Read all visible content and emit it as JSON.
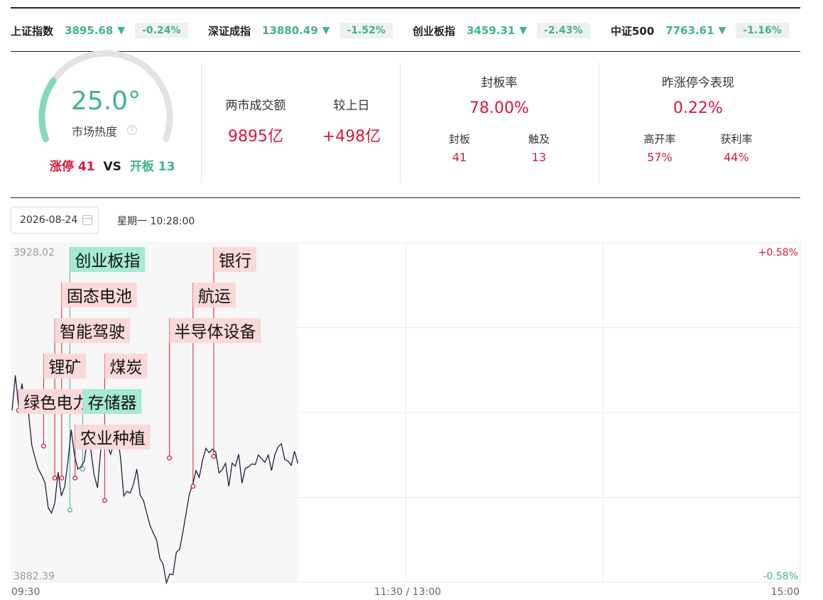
{
  "indices": [
    {
      "name": "上证指数",
      "value": "3895.68",
      "arrow": "▼",
      "change": "-0.24%"
    },
    {
      "name": "深证成指",
      "value": "13880.49",
      "arrow": "▼",
      "change": "-1.52%"
    },
    {
      "name": "创业板指",
      "value": "3459.31",
      "arrow": "▼",
      "change": "-2.43%"
    },
    {
      "name": "中证500",
      "value": "7763.61",
      "arrow": "▼",
      "change": "-1.16%"
    }
  ],
  "heat": {
    "value": "25.0°",
    "label": "市场热度",
    "help_icon": "?",
    "level": 0.25
  },
  "limit": {
    "up_label": "涨停",
    "up_count": "41",
    "vs": "VS",
    "open_label": "开板",
    "open_count": "13"
  },
  "turnover": {
    "label": "两市成交额",
    "value": "9895亿",
    "cmp_label": "较上日",
    "cmp_value": "+498亿"
  },
  "seal": {
    "label": "封板率",
    "value": "78.00%",
    "sealed_label": "封板",
    "sealed_value": "41",
    "touched_label": "触及",
    "touched_value": "13"
  },
  "yesterday": {
    "label": "昨涨停今表现",
    "value": "0.22%",
    "high_open_label": "高开率",
    "high_open_value": "57%",
    "profit_label": "获利率",
    "profit_value": "44%"
  },
  "date": {
    "value": "2026-08-24",
    "weekday_time": "星期一 10:28:00"
  },
  "colors": {
    "up": "#d9173b",
    "down": "#3fb38f",
    "line": "#1b2140"
  },
  "chart_data": {
    "type": "line",
    "ylim": [
      3882.39,
      3928.02
    ],
    "y_max_label": "3928.02",
    "y_min_label": "3882.39",
    "pct_max_label": "+0.58%",
    "pct_min_label": "-0.58%",
    "x_labels": [
      "09:30",
      "11:30 / 13:00",
      "15:00"
    ],
    "minutes_total": 240,
    "series_y": [
      3905.5,
      3910.2,
      3905.9,
      3909.1,
      3906.0,
      3905.2,
      3900.8,
      3899.1,
      3897.6,
      3896.8,
      3895.8,
      3892.4,
      3891.7,
      3893.0,
      3897.2,
      3894.0,
      3895.2,
      3898.5,
      3902.9,
      3899.5,
      3897.6,
      3897.9,
      3898.7,
      3902.0,
      3900.1,
      3896.8,
      3895.1,
      3900.2,
      3902.2,
      3900.8,
      3899.6,
      3901.1,
      3902.2,
      3899.3,
      3894.0,
      3894.6,
      3894.4,
      3895.6,
      3897.6,
      3894.1,
      3893.4,
      3891.7,
      3890.0,
      3889.0,
      3888.1,
      3885.6,
      3884.8,
      3882.3,
      3883.5,
      3883.4,
      3886.4,
      3886.8,
      3889.1,
      3891.7,
      3894.3,
      3895.5,
      3897.4,
      3896.5,
      3898.8,
      3900.4,
      3899.8,
      3900.3,
      3899.9,
      3897.1,
      3897.5,
      3898.4,
      3895.3,
      3898.4,
      3898.0,
      3899.6,
      3895.7,
      3897.7,
      3897.9,
      3898.3,
      3898.2,
      3899.5,
      3899.0,
      3898.5,
      3899.5,
      3897.4,
      3899.5,
      3900.6,
      3901.0,
      3898.9,
      3898.7,
      3898.1,
      3900.0,
      3898.4
    ],
    "annotations": [
      {
        "label": "创业板指",
        "minute": 17.6,
        "y": 3892.1,
        "color": "green"
      },
      {
        "label": "固态电池",
        "minute": 15.1,
        "y": 3896.4,
        "color": "red"
      },
      {
        "label": "智能驾驶",
        "minute": 13.0,
        "y": 3896.4,
        "color": "red"
      },
      {
        "label": "锂矿",
        "minute": 9.6,
        "y": 3900.7,
        "color": "red"
      },
      {
        "label": "煤炭",
        "minute": 28.2,
        "y": 3893.4,
        "color": "red"
      },
      {
        "label": "绿色电力",
        "minute": 2.0,
        "y": 3905.5,
        "color": "red"
      },
      {
        "label": "存储器",
        "minute": 21.5,
        "y": 3897.6,
        "color": "green"
      },
      {
        "label": "农业种植",
        "minute": 19.2,
        "y": 3896.4,
        "color": "red"
      },
      {
        "label": "银行",
        "minute": 61.4,
        "y": 3899.3,
        "color": "red"
      },
      {
        "label": "航运",
        "minute": 55.1,
        "y": 3895.3,
        "color": "red"
      },
      {
        "label": "半导体设备",
        "minute": 47.9,
        "y": 3899.1,
        "color": "red"
      }
    ]
  }
}
